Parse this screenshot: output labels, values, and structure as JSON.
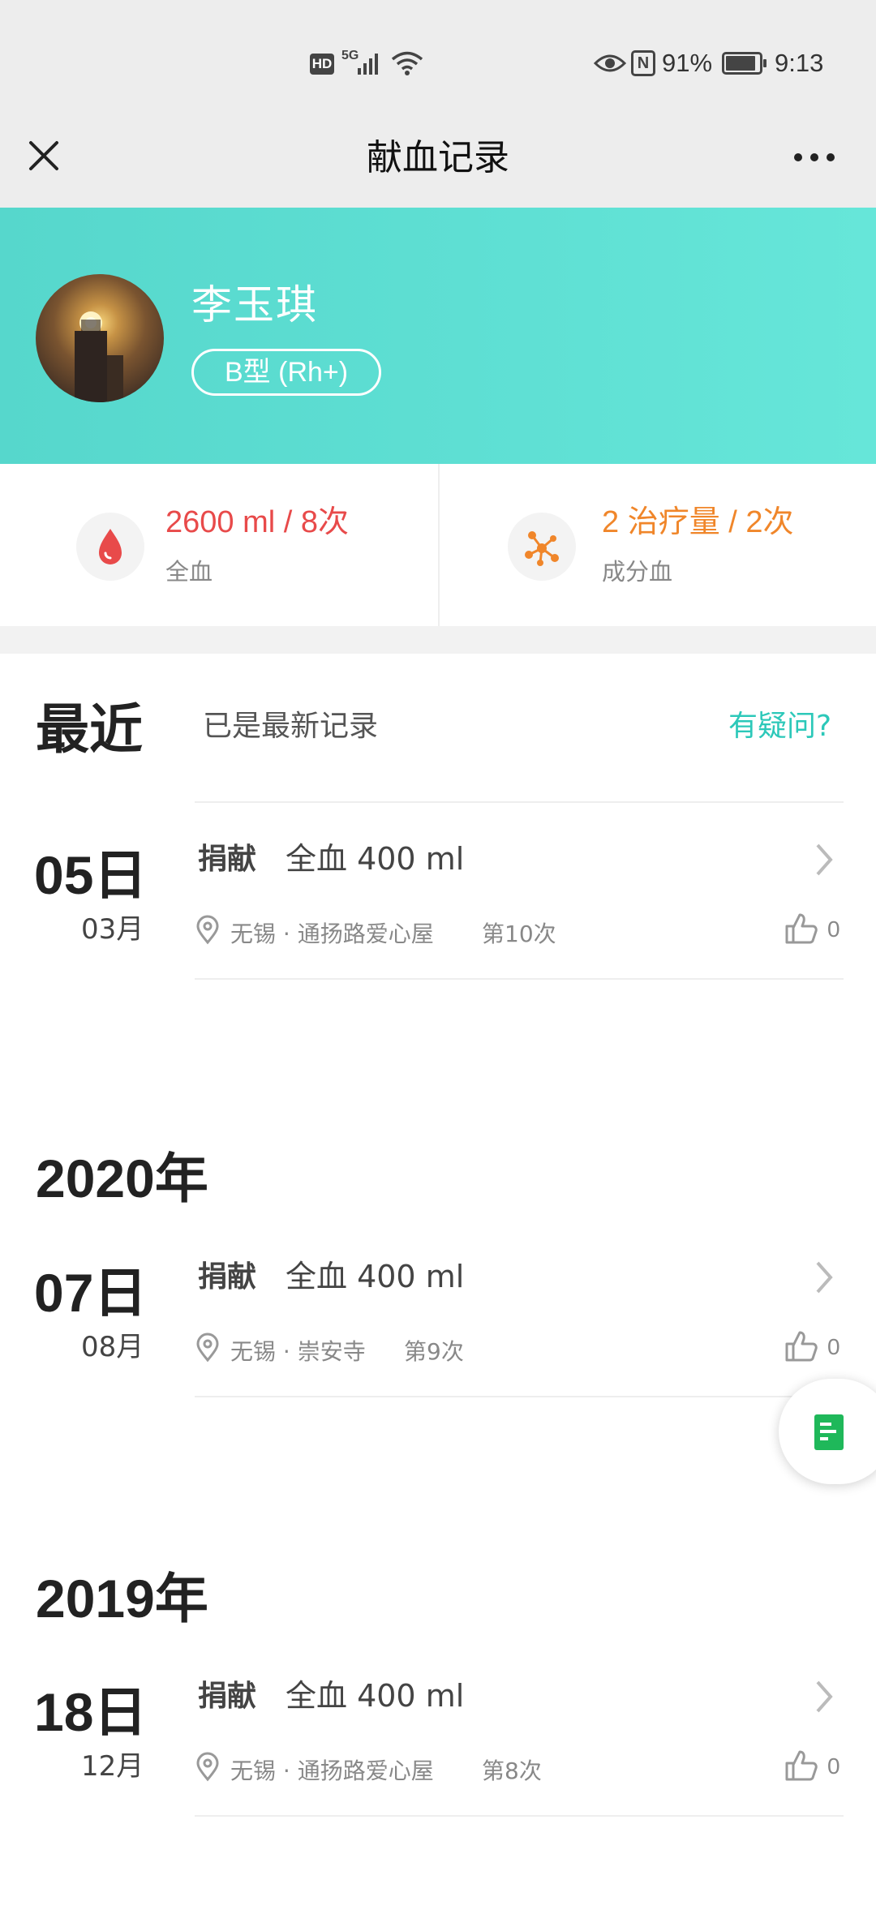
{
  "status_bar": {
    "network": "HD",
    "signal": "5G",
    "battery_percent": "91%",
    "time": "9:13"
  },
  "nav": {
    "title": "献血记录"
  },
  "profile": {
    "name": "李玉琪",
    "blood_type": "B型 (Rh+)"
  },
  "stats": {
    "whole_blood": {
      "value": "2600 ml / 8次",
      "label": "全血",
      "color": "#e84a4a"
    },
    "component_blood": {
      "value": "2 治疗量 / 2次",
      "label": "成分血",
      "color": "#f0862a"
    }
  },
  "latest_section": {
    "title": "最近",
    "status": "已是最新记录",
    "question_link": "有疑问?"
  },
  "year_sections": [
    "2020年",
    "2019年"
  ],
  "records": [
    {
      "day": "05日",
      "month": "03月",
      "type": "捐献",
      "amount": "全血 400 ml",
      "location": "无锡 · 通扬路爱心屋",
      "count": "第10次",
      "likes": "0"
    },
    {
      "day": "07日",
      "month": "08月",
      "type": "捐献",
      "amount": "全血 400 ml",
      "location": "无锡 · 崇安寺",
      "count": "第9次",
      "likes": "0"
    },
    {
      "day": "18日",
      "month": "12月",
      "type": "捐献",
      "amount": "全血 400 ml",
      "location": "无锡 · 通扬路爱心屋",
      "count": "第8次",
      "likes": "0"
    }
  ],
  "colors": {
    "accent": "#5fe0d4",
    "link": "#2cc8b9",
    "fab_icon": "#1fb85a"
  }
}
